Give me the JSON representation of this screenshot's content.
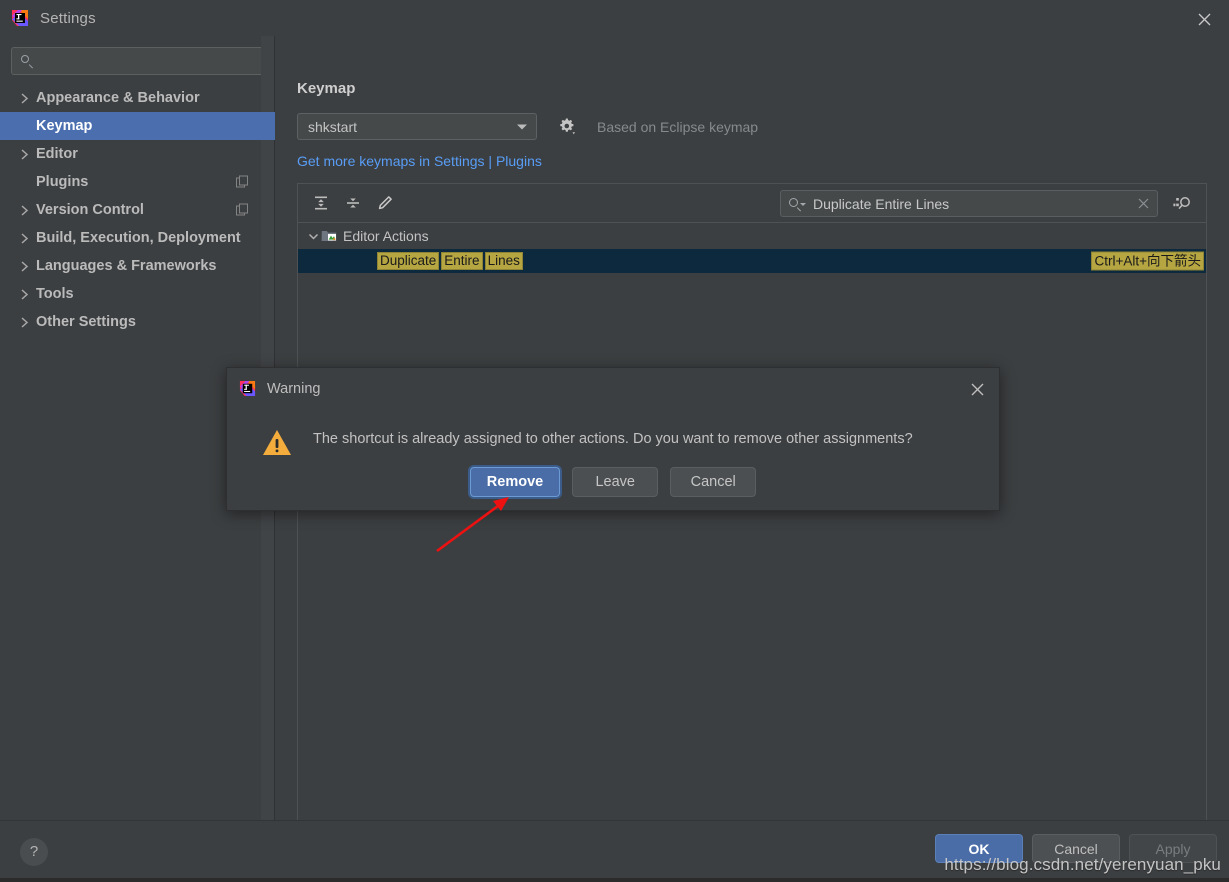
{
  "window": {
    "title": "Settings",
    "app_icon": "intellij-idea-icon",
    "close_icon": "close-icon"
  },
  "sidebar": {
    "search": {
      "value": "",
      "placeholder": "",
      "icon": "search-icon"
    },
    "items": [
      {
        "label": "Appearance & Behavior",
        "expandable": true,
        "selected": false,
        "badge": null
      },
      {
        "label": "Keymap",
        "expandable": false,
        "selected": true,
        "badge": null
      },
      {
        "label": "Editor",
        "expandable": true,
        "selected": false,
        "badge": null
      },
      {
        "label": "Plugins",
        "expandable": false,
        "selected": false,
        "badge": "copy-badge-icon"
      },
      {
        "label": "Version Control",
        "expandable": true,
        "selected": false,
        "badge": "copy-badge-icon"
      },
      {
        "label": "Build, Execution, Deployment",
        "expandable": true,
        "selected": false,
        "badge": null
      },
      {
        "label": "Languages & Frameworks",
        "expandable": true,
        "selected": false,
        "badge": null
      },
      {
        "label": "Tools",
        "expandable": true,
        "selected": false,
        "badge": null
      },
      {
        "label": "Other Settings",
        "expandable": true,
        "selected": false,
        "badge": null
      }
    ]
  },
  "main": {
    "page_title": "Keymap",
    "keymap_select": {
      "value": "shkstart",
      "arrow_icon": "chevron-down-icon"
    },
    "gear_icon": "gear-icon",
    "based_on": "Based on Eclipse keymap",
    "plugins_link": "Get more keymaps in Settings | Plugins",
    "toolbar": [
      {
        "icon": "expand-all-icon",
        "name": "expand-all-button"
      },
      {
        "icon": "collapse-all-icon",
        "name": "collapse-all-button"
      },
      {
        "icon": "edit-pencil-icon",
        "name": "edit-shortcut-button"
      }
    ],
    "find": {
      "value": "Duplicate Entire Lines",
      "placeholder": "",
      "search_icon": "search-dropdown-icon",
      "clear_icon": "clear-icon"
    },
    "find_by_shortcut_icon": "find-by-shortcut-icon",
    "tree": {
      "group": {
        "label": "Editor Actions",
        "expanded": true,
        "chevron_icon": "chevron-down-icon",
        "folder_icon": "editor-actions-folder-icon"
      },
      "action": {
        "highlighted_words": [
          "Duplicate",
          "Entire",
          "Lines"
        ],
        "shortcut": "Ctrl+Alt+向下箭头",
        "selected": true
      }
    }
  },
  "bottom_bar": {
    "help_icon": "help-icon",
    "buttons": [
      {
        "label": "OK",
        "style": "primary"
      },
      {
        "label": "Cancel",
        "style": "default"
      },
      {
        "label": "Apply",
        "style": "disabled"
      }
    ]
  },
  "modal": {
    "title": "Warning",
    "title_icon": "intellij-idea-icon",
    "close_icon": "close-icon",
    "warning_icon": "warning-triangle-icon",
    "message": "The shortcut is already assigned to other actions. Do you want to remove other assignments?",
    "buttons": [
      {
        "label": "Remove",
        "focused": true
      },
      {
        "label": "Leave",
        "focused": false
      },
      {
        "label": "Cancel",
        "focused": false
      }
    ]
  },
  "annotation": {
    "arrow_color": "#ee1111",
    "arrow_name": "red-arrow-annotation"
  },
  "watermark": {
    "text": "https://blog.csdn.net/yerenyuan_pku"
  },
  "colors": {
    "accent_blue": "#4b6eaf",
    "link_blue": "#589df6",
    "highlight_yellow": "#b5a642",
    "selected_row_blue": "#0d293e",
    "panel_bg": "#3c3f41",
    "warning_orange": "#f4ad3d"
  }
}
